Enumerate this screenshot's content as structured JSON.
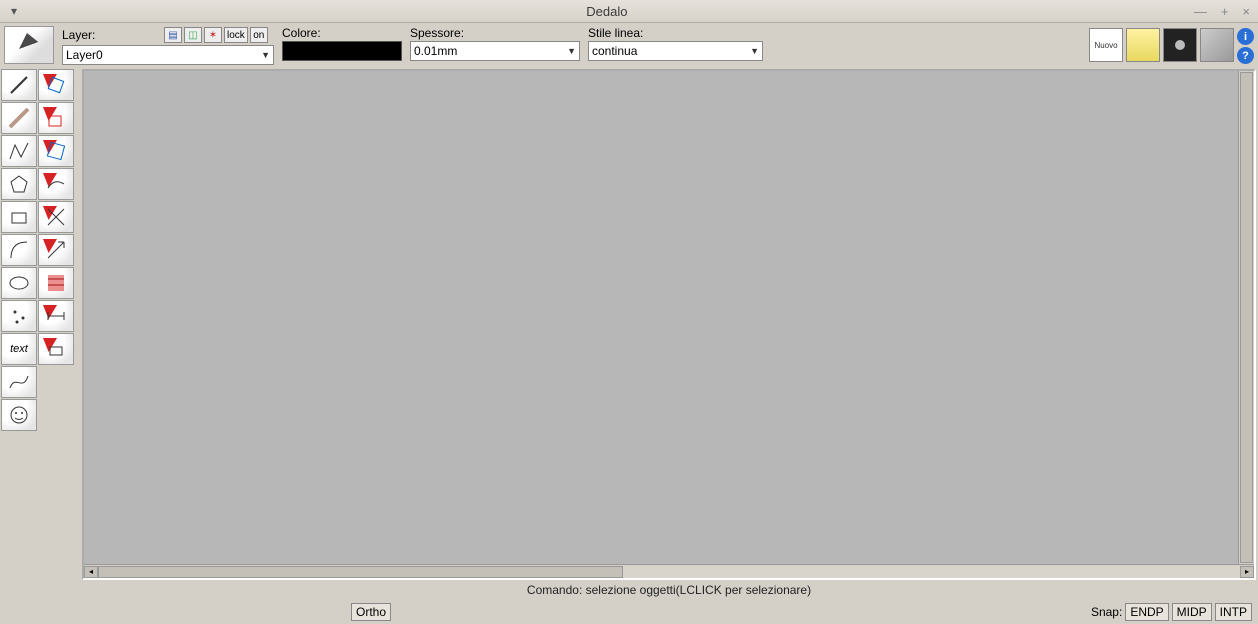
{
  "titlebar": {
    "title": "Dedalo"
  },
  "toolbar": {
    "layer_label": "Layer:",
    "layer_selected": "Layer0",
    "lock_label": "lock",
    "on_label": "on",
    "colore_label": "Colore:",
    "colore_value": "#000000",
    "spessore_label": "Spessore:",
    "spessore_selected": "0.01mm",
    "linea_label": "Stile linea:",
    "linea_selected": "continua",
    "nuovo_label": "Nuovo"
  },
  "toolbox": {
    "rows": [
      [
        "line-tool",
        "move-tool"
      ],
      [
        "segment-tool",
        "rotate-tool"
      ],
      [
        "polyline-tool",
        "scale-tool"
      ],
      [
        "polygon-tool",
        "chamfer-tool"
      ],
      [
        "rectangle-tool",
        "trim-tool"
      ],
      [
        "arc-tool",
        "extend-tool"
      ],
      [
        "ellipse-tool",
        "hatch-tool"
      ],
      [
        "point-tool",
        "dimension-tool"
      ],
      [
        "text-tool",
        "measure-tool"
      ],
      [
        "spline-tool",
        ""
      ],
      [
        "face-tool",
        ""
      ]
    ],
    "text_label": "text"
  },
  "status": {
    "comando": "Comando: selezione oggetti(LCLICK per selezionare)",
    "ortho": "Ortho",
    "snap_label": "Snap:",
    "snap_endp": "ENDP",
    "snap_midp": "MIDP",
    "snap_intp": "INTP"
  }
}
